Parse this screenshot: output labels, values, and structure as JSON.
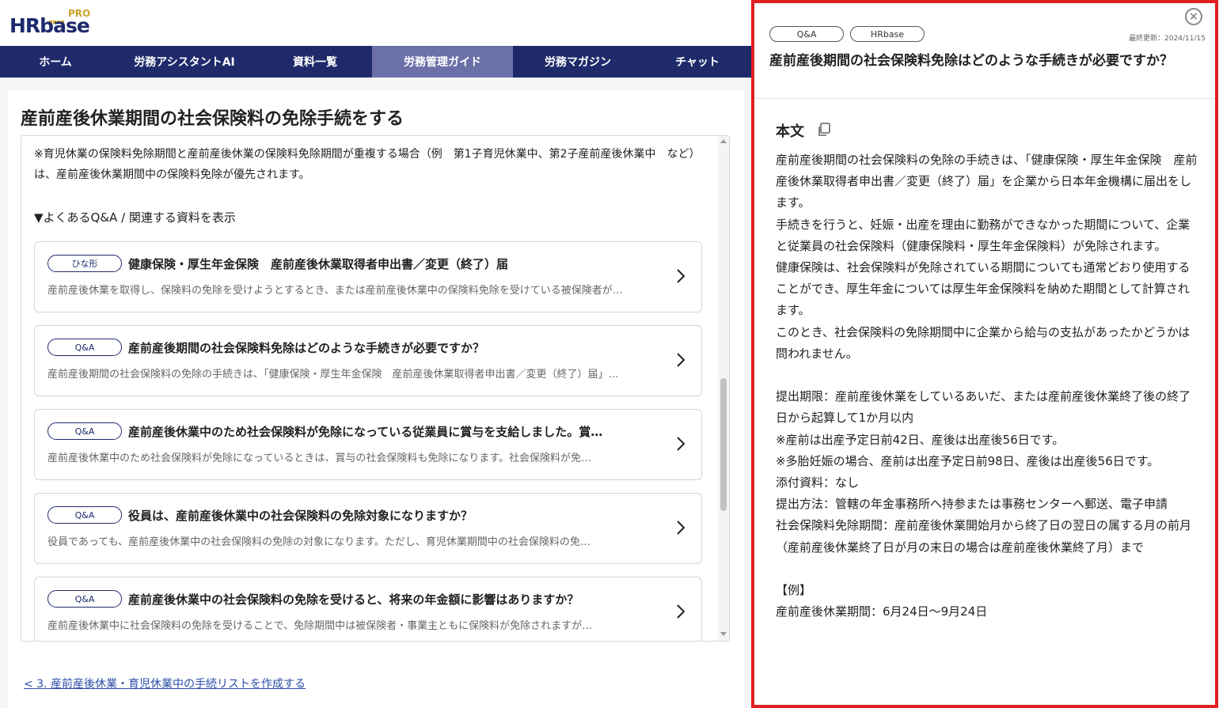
{
  "logo": {
    "main": "HRbase",
    "pro": "PRO"
  },
  "nav": [
    {
      "label": "ホーム",
      "active": false
    },
    {
      "label": "労務アシスタントAI",
      "active": false
    },
    {
      "label": "資料一覧",
      "active": false
    },
    {
      "label": "労務管理ガイド",
      "active": true
    },
    {
      "label": "労務マガジン",
      "active": false
    },
    {
      "label": "チャット",
      "active": false
    }
  ],
  "main": {
    "title": "産前産後休業期間の社会保険料の免除手続をする",
    "note": "※育児休業の保険料免除期間と産前産後休業の保険料免除期間が重複する場合（例　第1子育児休業中、第2子産前産後休業中　など）は、産前産後休業期間中の保険料免除が優先されます。",
    "toggle": "▼よくあるQ&A / 関連する資料を表示",
    "cards": [
      {
        "tag": "ひな形",
        "title": "健康保険・厚生年金保険　産前産後休業取得者申出書／変更（終了）届",
        "desc": "産前産後休業を取得し、保険料の免除を受けようとするとき、または産前産後休業中の保険料免除を受けている被保険者が…"
      },
      {
        "tag": "Q&A",
        "title": "産前産後期間の社会保険料免除はどのような手続きが必要ですか？",
        "desc": "産前産後期間の社会保険料の免除の手続きは、「健康保険・厚生年金保険　産前産後休業取得者申出書／変更（終了）届」…"
      },
      {
        "tag": "Q&A",
        "title": "産前産後休業中のため社会保険料が免除になっている従業員に賞与を支給しました。賞…",
        "desc": "産前産後休業中のため社会保険料が免除になっているときは、賞与の社会保険料も免除になります。社会保険料が免…"
      },
      {
        "tag": "Q&A",
        "title": "役員は、産前産後休業中の社会保険料の免除対象になりますか？",
        "desc": "役員であっても、産前産後休業中の社会保険料の免除の対象になります。ただし、育児休業期間中の社会保険料の免…"
      },
      {
        "tag": "Q&A",
        "title": "産前産後休業中の社会保険料の免除を受けると、将来の年金額に影響はありますか？",
        "desc": "産前産後休業中に社会保険料の免除を受けることで、免除期間中は被保険者・事業主ともに保険料が免除されますが…"
      }
    ],
    "back_link": "< 3. 産前産後休業・育児休業中の手続リストを作成する"
  },
  "panel": {
    "tags": [
      "Q&A",
      "HRbase"
    ],
    "updated": "最終更新：2024/11/15",
    "title": "産前産後期間の社会保険料免除はどのような手続きが必要ですか？",
    "body_heading": "本文",
    "paragraphs": [
      "産前産後期間の社会保険料の免除の手続きは、「健康保険・厚生年金保険　産前産後休業取得者申出書／変更（終了）届」を企業から日本年金機構に届出をします。",
      "手続きを行うと、妊娠・出産を理由に勤務ができなかった期間について、企業と従業員の社会保険料（健康保険料・厚生年金保険料）が免除されます。",
      "健康保険は、社会保険料が免除されている期間についても通常どおり使用することができ、厚生年金については厚生年金保険料を納めた期間として計算されます。",
      "このとき、社会保険料の免除期間中に企業から給与の支払があったかどうかは問われません。",
      "",
      "提出期限：産前産後休業をしているあいだ、または産前産後休業終了後の終了日から起算して1か月以内",
      "※産前は出産予定日前42日、産後は出産後56日です。",
      "※多胎妊娠の場合、産前は出産予定日前98日、産後は出産後56日です。",
      "添付資料：なし",
      "提出方法：管轄の年金事務所へ持参または事務センターへ郵送、電子申請",
      "社会保険料免除期間：産前産後休業開始月から終了日の翌日の属する月の前月（産前産後休業終了日が月の末日の場合は産前産後休業終了月）まで",
      "",
      "【例】",
      "産前産後休業期間：6月24日～9月24日"
    ]
  }
}
